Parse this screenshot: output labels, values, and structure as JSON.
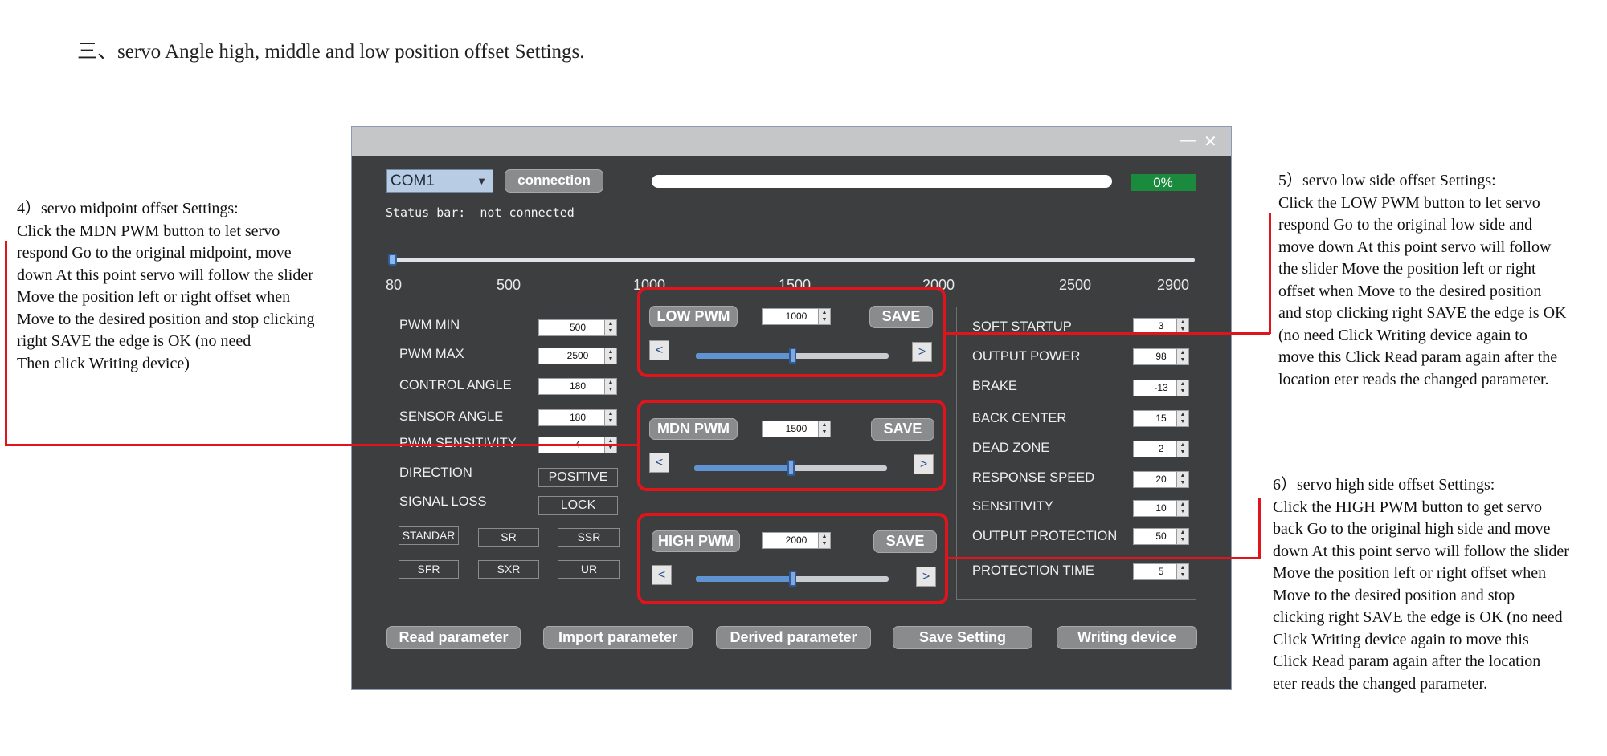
{
  "heading": "三、servo Angle high, middle and low position offset Settings.",
  "notes": {
    "left": [
      "4）servo midpoint offset Settings:",
      "Click the MDN PWM button to let servo",
      "respond Go to the original midpoint, move",
      "down At this point servo will follow the slider",
      "Move the position left or right offset when",
      "Move to the desired position and stop clicking",
      "right SAVE the edge is OK (no need",
      "Then click Writing device)"
    ],
    "right_top": [
      "5）servo low side offset Settings:",
      "Click the LOW PWM button to let servo",
      "respond Go to the original low side and",
      "move down At this point servo will follow",
      "the slider Move the position left or right",
      "offset when Move to the desired position",
      "and stop clicking right SAVE the edge is OK",
      "(no need Click Writing device again to",
      "move this Click Read param again after the",
      "location eter reads the changed parameter."
    ],
    "right_bottom": [
      "6）servo high side offset Settings:",
      "Click the HIGH PWM button to get servo",
      "back Go to the original high side and move",
      "down At this point servo will follow the slider",
      "Move the position left or right offset when",
      "Move to the desired position and stop",
      "clicking right SAVE the edge is OK (no need",
      "Click Writing device again to move this",
      "Click Read param again after the location",
      "eter reads the changed parameter."
    ]
  },
  "window": {
    "minimize": "—",
    "close": "✕",
    "com_port": "COM1",
    "connect_label": "connection",
    "progress_percent": 0,
    "progress_text": "0%",
    "status_text": "Status bar:  not connected",
    "main_slider": {
      "min": 80,
      "max": 2900,
      "value": 80,
      "ticks": [
        "80",
        "500",
        "1000",
        "1500",
        "2000",
        "2500",
        "2900"
      ]
    },
    "left_params": [
      {
        "label": "PWM MIN",
        "value": "500"
      },
      {
        "label": "PWM MAX",
        "value": "2500"
      },
      {
        "label": "CONTROL ANGLE",
        "value": "180"
      },
      {
        "label": "SENSOR ANGLE",
        "value": "180"
      },
      {
        "label": "PWM SENSITIVITY",
        "value": "4"
      }
    ],
    "direction_label": "DIRECTION",
    "direction_value": "POSITIVE",
    "signal_label": "SIGNAL LOSS",
    "signal_value": "LOCK",
    "modes": [
      "STANDAR",
      "SR",
      "SSR",
      "SFR",
      "SXR",
      "UR"
    ],
    "pwm_panels": [
      {
        "label": "LOW PWM",
        "value": "1000",
        "save": "SAVE",
        "slider_fraction": 0.5
      },
      {
        "label": "MDN PWM",
        "value": "1500",
        "save": "SAVE",
        "slider_fraction": 0.5
      },
      {
        "label": "HIGH PWM",
        "value": "2000",
        "save": "SAVE",
        "slider_fraction": 0.5
      }
    ],
    "arrow_left": "<",
    "arrow_right": ">",
    "right_params": [
      {
        "label": "SOFT STARTUP",
        "value": "3"
      },
      {
        "label": "OUTPUT POWER",
        "value": "98"
      },
      {
        "label": "BRAKE",
        "value": "-13"
      },
      {
        "label": "BACK CENTER",
        "value": "15"
      },
      {
        "label": "DEAD ZONE",
        "value": "2"
      },
      {
        "label": "RESPONSE SPEED",
        "value": "20"
      },
      {
        "label": "SENSITIVITY",
        "value": "10"
      },
      {
        "label": "OUTPUT PROTECTION",
        "value": "50"
      },
      {
        "label": "PROTECTION TIME",
        "value": "5"
      }
    ],
    "bottom_buttons": [
      "Read parameter",
      "Import parameter",
      "Derived parameter",
      "Save Setting",
      "Writing device"
    ]
  },
  "colors": {
    "annotation": "#e0141b",
    "window_bg": "#3d3e40",
    "progress_green": "#1a8a3c"
  }
}
